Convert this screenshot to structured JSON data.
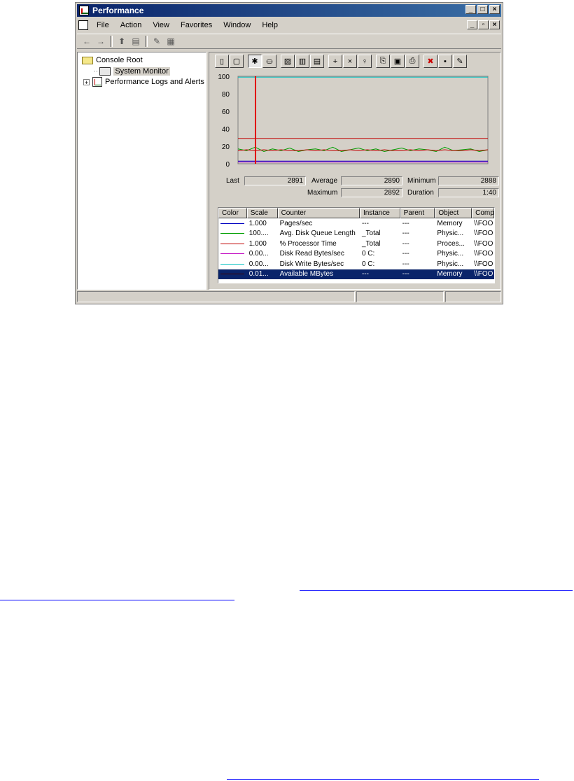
{
  "window": {
    "title": "Performance",
    "caption_buttons": {
      "minimize": "_",
      "maximize": "□",
      "close": "×"
    },
    "mdi_buttons": {
      "minimize": "_",
      "restore": "▫",
      "close": "×"
    }
  },
  "menu": [
    "File",
    "Action",
    "View",
    "Favorites",
    "Window",
    "Help"
  ],
  "toolbar": {
    "back": "←",
    "forward": "→",
    "up": "⬆",
    "show_hide_tree": "▤",
    "properties": "✎",
    "help": "▦"
  },
  "tree": {
    "root": "Console Root",
    "items": [
      {
        "label": "System Monitor",
        "selected": true
      },
      {
        "label": "Performance Logs and Alerts",
        "expander": "+"
      }
    ]
  },
  "sysmon_toolbar": [
    "▯",
    "▢",
    "✱",
    "⛀",
    "▨",
    "▥",
    "▤",
    "+",
    "×",
    "♀",
    "⎘",
    "▣",
    "⎙",
    "✖",
    "▪",
    "✎"
  ],
  "chart_data": {
    "type": "line",
    "ylim": [
      0,
      100
    ],
    "yticks": [
      "100",
      "80",
      "60",
      "40",
      "20",
      "0"
    ],
    "time_bar_position": 0.07,
    "series": [
      {
        "name": "Disk Write Bytes/sec",
        "color": "#00c0c0",
        "values": [
          99,
          99,
          99,
          99,
          99,
          99,
          99,
          99,
          99,
          99
        ]
      },
      {
        "name": "% Processor Time",
        "color": "#c00000",
        "values": [
          29,
          29,
          29,
          29,
          29,
          29,
          29,
          29,
          29,
          29
        ]
      },
      {
        "name": "Avg. Disk Queue Length",
        "color": "#00a000",
        "values": [
          17,
          15,
          19,
          14,
          17,
          15,
          18,
          14,
          16,
          17,
          15,
          19,
          14,
          16,
          18,
          15,
          17,
          14,
          16,
          18,
          15,
          17,
          16,
          14,
          19,
          15,
          16,
          17,
          14,
          16
        ]
      },
      {
        "name": "Pages/sec",
        "color": "#c00000",
        "values": [
          15,
          16,
          15,
          16,
          15,
          16,
          15,
          15,
          16,
          15,
          16,
          15,
          15,
          16,
          15,
          16,
          15,
          16,
          15,
          15,
          16,
          15,
          16,
          15,
          16,
          15,
          15,
          16,
          15,
          16
        ]
      },
      {
        "name": "Disk Read Bytes/sec",
        "color": "#c000c0",
        "values": [
          2,
          2,
          2,
          2,
          2,
          2,
          2,
          2,
          2,
          2
        ]
      },
      {
        "name": "Available MBytes",
        "color": "#0000c0",
        "values": [
          3,
          3,
          3,
          3,
          3,
          3,
          3,
          3,
          3,
          3
        ]
      }
    ]
  },
  "stats": {
    "last_label": "Last",
    "last": "2891",
    "average_label": "Average",
    "average": "2890",
    "minimum_label": "Minimum",
    "minimum": "2888",
    "maximum_label": "Maximum",
    "maximum": "2892",
    "duration_label": "Duration",
    "duration": "1:40"
  },
  "legend": {
    "headers": [
      "Color",
      "Scale",
      "Counter",
      "Instance",
      "Parent",
      "Object",
      "Comp"
    ],
    "rows": [
      {
        "color": "#0000c0",
        "scale": "1.000",
        "counter": "Pages/sec",
        "instance": "---",
        "parent": "---",
        "object": "Memory",
        "computer": "\\\\FOO"
      },
      {
        "color": "#00a000",
        "scale": "100....",
        "counter": "Avg. Disk Queue Length",
        "instance": "_Total",
        "parent": "---",
        "object": "Physic...",
        "computer": "\\\\FOO"
      },
      {
        "color": "#c00000",
        "scale": "1.000",
        "counter": "% Processor Time",
        "instance": "_Total",
        "parent": "---",
        "object": "Proces...",
        "computer": "\\\\FOO"
      },
      {
        "color": "#c000c0",
        "scale": "0.00...",
        "counter": "Disk Read Bytes/sec",
        "instance": "0 C:",
        "parent": "---",
        "object": "Physic...",
        "computer": "\\\\FOO"
      },
      {
        "color": "#00c0c0",
        "scale": "0.00...",
        "counter": "Disk Write Bytes/sec",
        "instance": "0 C:",
        "parent": "---",
        "object": "Physic...",
        "computer": "\\\\FOO"
      },
      {
        "color": "#400000",
        "scale": "0.01...",
        "counter": "Available MBytes",
        "instance": "---",
        "parent": "---",
        "object": "Memory",
        "computer": "\\\\FOO",
        "selected": true
      }
    ]
  }
}
